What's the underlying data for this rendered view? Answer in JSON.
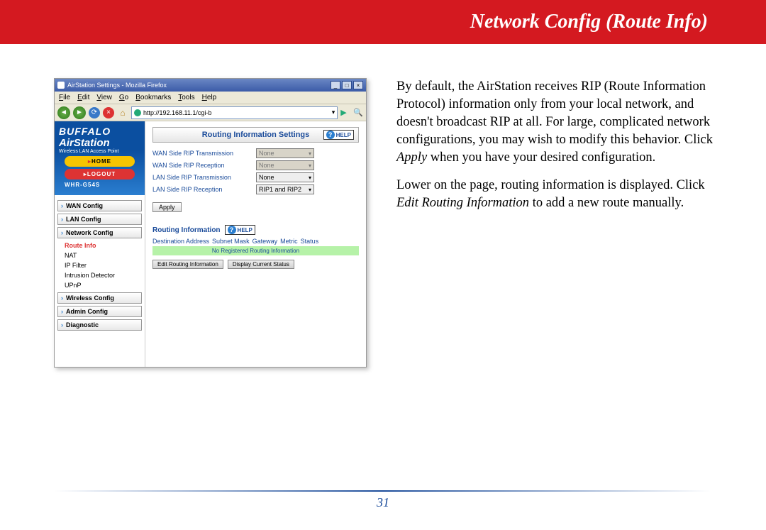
{
  "banner": {
    "title": "Network Config (Route Info)"
  },
  "page_number": "31",
  "body": {
    "p1a": "By default, the AirStation receives RIP (Route Information Protocol) information only from your local network, and doesn't broadcast RIP at all.  For large, complicated network configurations, you may wish to modify this behavior.  Click ",
    "p1_em": "Apply",
    "p1b": " when you have your desired configuration.",
    "p2a": "Lower on the page, routing information is displayed.  Click ",
    "p2_em": "Edit Routing Information",
    "p2b": " to add a new route manually."
  },
  "browser": {
    "window_title": "AirStation Settings - Mozilla Firefox",
    "menus": [
      "File",
      "Edit",
      "View",
      "Go",
      "Bookmarks",
      "Tools",
      "Help"
    ],
    "url": "http://192.168.11.1/cgi-b"
  },
  "sidebar": {
    "brand_top": "BUFFALO",
    "brand_main": "AirStation",
    "brand_sub": "Wireless LAN Access Point",
    "home": "HOME",
    "logout": "LOGOUT",
    "model": "WHR-G54S",
    "items": [
      {
        "label": "WAN Config",
        "type": "btn"
      },
      {
        "label": "LAN Config",
        "type": "btn"
      },
      {
        "label": "Network Config",
        "type": "btn"
      },
      {
        "label": "Route Info",
        "type": "sub",
        "active": true
      },
      {
        "label": "NAT",
        "type": "sub"
      },
      {
        "label": "IP Filter",
        "type": "sub"
      },
      {
        "label": "Intrusion Detector",
        "type": "sub"
      },
      {
        "label": "UPnP",
        "type": "sub"
      },
      {
        "label": "Wireless Config",
        "type": "btn"
      },
      {
        "label": "Admin Config",
        "type": "btn"
      },
      {
        "label": "Diagnostic",
        "type": "btn"
      }
    ]
  },
  "main": {
    "section_title": "Routing Information Settings",
    "help": "HELP",
    "rows": [
      {
        "label": "WAN Side RIP Transmission",
        "value": "None",
        "disabled": true
      },
      {
        "label": "WAN Side RIP Reception",
        "value": "None",
        "disabled": true
      },
      {
        "label": "LAN Side RIP Transmission",
        "value": "None",
        "disabled": false
      },
      {
        "label": "LAN Side RIP Reception",
        "value": "RIP1 and RIP2",
        "disabled": false
      }
    ],
    "apply": "Apply",
    "sub_title": "Routing Information",
    "table_cols": [
      "Destination Address",
      "Subnet Mask",
      "Gateway",
      "Metric",
      "Status"
    ],
    "empty_msg": "No Registered Routing Information",
    "btn_edit": "Edit Routing Information",
    "btn_display": "Display Current Status"
  }
}
